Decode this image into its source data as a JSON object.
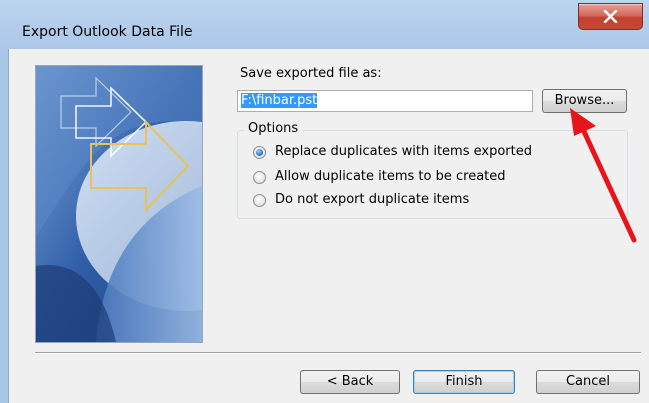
{
  "window": {
    "title": "Export Outlook Data File",
    "close_label": "x"
  },
  "save": {
    "label": "Save exported file as:",
    "path_value": "F:\\finbar.pst",
    "browse_label": "Browse..."
  },
  "options": {
    "legend": "Options",
    "items": [
      {
        "label": "Replace duplicates with items exported",
        "checked": true
      },
      {
        "label": "Allow duplicate items to be created",
        "checked": false
      },
      {
        "label": "Do not export duplicate items",
        "checked": false
      }
    ]
  },
  "buttons": {
    "back_label": "< Back",
    "finish_label": "Finish",
    "cancel_label": "Cancel"
  },
  "colors": {
    "frame_blue": "#a9c5e8",
    "close_red": "#c7473a",
    "annotation_red": "#e8141c",
    "selection_blue": "#3399ff"
  }
}
